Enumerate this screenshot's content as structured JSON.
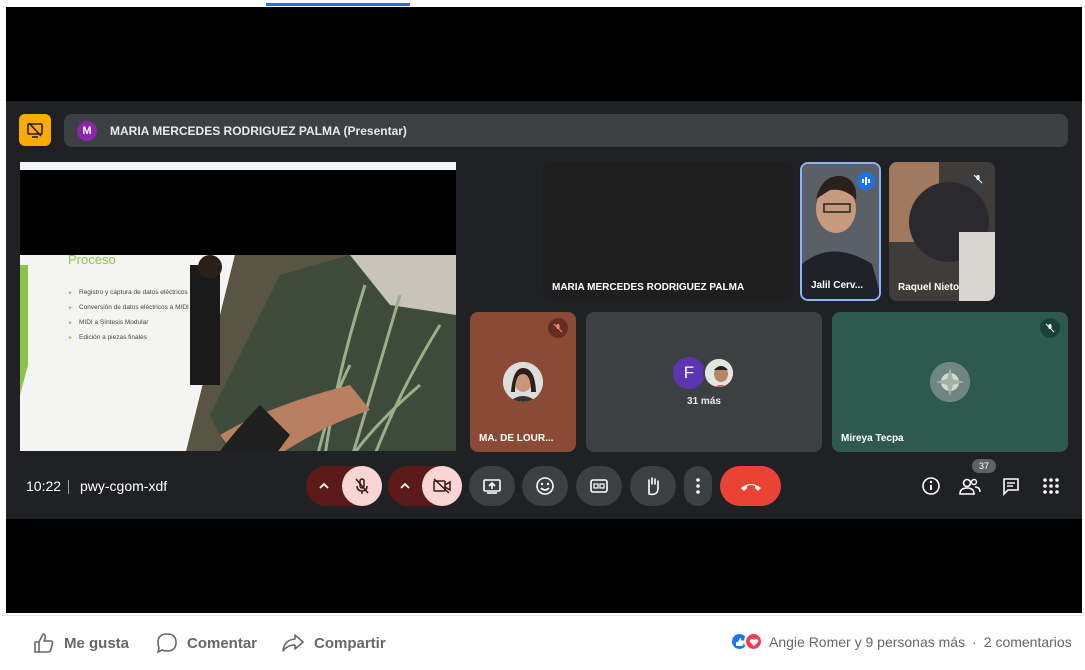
{
  "presentation": {
    "avatar_letter": "M",
    "presenter_label": "MARIA MERCEDES RODRIGUEZ PALMA (Presentar)"
  },
  "slide": {
    "title": "Proceso",
    "bullets": [
      "Registro y captura de datos eléctricos",
      "Conversión de datos eléctricos a MIDI",
      "MIDI a Síntesis Modular",
      "Edición a piezas finales"
    ]
  },
  "tiles": {
    "maria": {
      "name": "MARIA MERCEDES RODRIGUEZ PALMA"
    },
    "jalil": {
      "name": "Jalil Cerv..."
    },
    "raquel": {
      "name": "Raquel Nieto"
    },
    "lour": {
      "name": "MA. DE LOUR..."
    },
    "more": {
      "avatar_letter": "F",
      "label": "31 más"
    },
    "mireya": {
      "name": "Mireya Tecpa"
    }
  },
  "meeting": {
    "time": "10:22",
    "code": "pwy-cgom-xdf",
    "participants_count": "37"
  },
  "facebook": {
    "like_label": "Me gusta",
    "comment_label": "Comentar",
    "share_label": "Compartir",
    "reactions_text": "Angie Romer y 9 personas más",
    "dot": "·",
    "comments_text": "2 comentarios"
  },
  "colors": {
    "meet_bg": "#202124",
    "presenter_icon": "#f9ab00",
    "end_call": "#ea4335",
    "mic_off_bg": "#f9d6d5",
    "accent_blue": "#1a73e8"
  }
}
